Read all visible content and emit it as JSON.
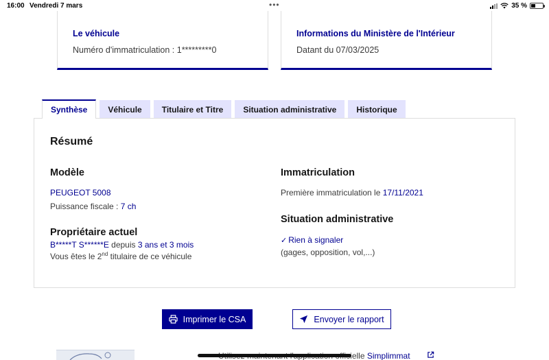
{
  "status_bar": {
    "time": "16:00",
    "date": "Vendredi 7 mars",
    "battery": "35 %",
    "battery_level": 0.35
  },
  "cards": {
    "vehicle": {
      "title": "Le véhicule",
      "text": "Numéro d'immatriculation : 1*********0"
    },
    "ministry": {
      "title": "Informations du Ministère de l'Intérieur",
      "text": "Datant du 07/03/2025"
    }
  },
  "tabs": [
    {
      "label": "Synthèse",
      "active": true
    },
    {
      "label": "Véhicule",
      "active": false
    },
    {
      "label": "Titulaire et Titre",
      "active": false
    },
    {
      "label": "Situation administrative",
      "active": false
    },
    {
      "label": "Historique",
      "active": false
    }
  ],
  "summary": {
    "heading": "Résumé",
    "model": {
      "heading": "Modèle",
      "name": "PEUGEOT 5008",
      "power_label": "Puissance fiscale : ",
      "power_value": "7 ch"
    },
    "owner": {
      "heading": "Propriétaire actuel",
      "name": "B*****T S******E",
      "since_label": " depuis ",
      "since_value": "3 ans et 3 mois",
      "rank_prefix": "Vous êtes le 2",
      "rank_sup": "nd",
      "rank_suffix": " titulaire de ce véhicule"
    },
    "registration": {
      "heading": "Immatriculation",
      "first_label": "Première immatriculation le ",
      "first_date": "17/11/2021"
    },
    "admin": {
      "heading": "Situation administrative",
      "status": "Rien à signaler",
      "details": "(gages, opposition, vol,...)"
    }
  },
  "actions": {
    "print": "Imprimer le CSA",
    "send": "Envoyer le rapport"
  },
  "footer": {
    "text": "Utilisez maintenant l'application officielle ",
    "link": "Simplimmat"
  },
  "colors": {
    "primary": "#000091",
    "tab_bg": "#e3e3fd"
  }
}
